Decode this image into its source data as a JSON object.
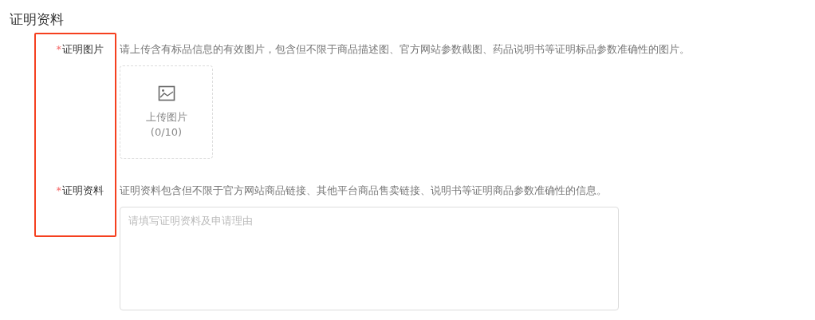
{
  "section_title": "证明资料",
  "fields": [
    {
      "kind": "upload",
      "label": "证明图片",
      "required_mark": "*",
      "hint": "请上传含有标品信息的有效图片，包含但不限于商品描述图、官方网站参数截图、药品说明书等证明标品参数准确性的图片。",
      "upload_label": "上传图片",
      "upload_count": "(0/10)"
    },
    {
      "kind": "textarea",
      "label": "证明资料",
      "required_mark": "*",
      "hint": "证明资料包含但不限于官方网站商品链接、其他平台商品售卖链接、说明书等证明商品参数准确性的信息。",
      "placeholder": "请填写证明资料及申请理由"
    }
  ]
}
